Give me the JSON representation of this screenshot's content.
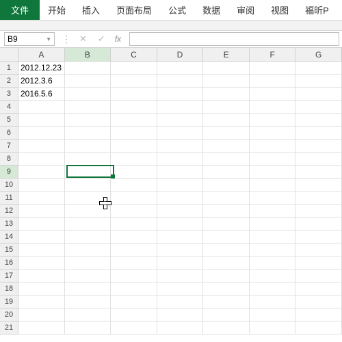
{
  "ribbon": {
    "file": "文件",
    "tabs": [
      "开始",
      "插入",
      "页面布局",
      "公式",
      "数据",
      "审阅",
      "视图",
      "福昕P"
    ]
  },
  "formula_bar": {
    "name_box": "B9",
    "cancel": "✕",
    "confirm": "✓",
    "fx": "fx",
    "value": ""
  },
  "columns": [
    "A",
    "B",
    "C",
    "D",
    "E",
    "F",
    "G"
  ],
  "active_col": "B",
  "rows": [
    {
      "n": 1,
      "cells": [
        "2012.12.23",
        "",
        "",
        "",
        "",
        "",
        ""
      ]
    },
    {
      "n": 2,
      "cells": [
        "2012.3.6",
        "",
        "",
        "",
        "",
        "",
        ""
      ]
    },
    {
      "n": 3,
      "cells": [
        "2016.5.6",
        "",
        "",
        "",
        "",
        "",
        ""
      ]
    },
    {
      "n": 4,
      "cells": [
        "",
        "",
        "",
        "",
        "",
        "",
        ""
      ]
    },
    {
      "n": 5,
      "cells": [
        "",
        "",
        "",
        "",
        "",
        "",
        ""
      ]
    },
    {
      "n": 6,
      "cells": [
        "",
        "",
        "",
        "",
        "",
        "",
        ""
      ]
    },
    {
      "n": 7,
      "cells": [
        "",
        "",
        "",
        "",
        "",
        "",
        ""
      ]
    },
    {
      "n": 8,
      "cells": [
        "",
        "",
        "",
        "",
        "",
        "",
        ""
      ]
    },
    {
      "n": 9,
      "cells": [
        "",
        "",
        "",
        "",
        "",
        "",
        ""
      ]
    },
    {
      "n": 10,
      "cells": [
        "",
        "",
        "",
        "",
        "",
        "",
        ""
      ]
    },
    {
      "n": 11,
      "cells": [
        "",
        "",
        "",
        "",
        "",
        "",
        ""
      ]
    },
    {
      "n": 12,
      "cells": [
        "",
        "",
        "",
        "",
        "",
        "",
        ""
      ]
    },
    {
      "n": 13,
      "cells": [
        "",
        "",
        "",
        "",
        "",
        "",
        ""
      ]
    },
    {
      "n": 14,
      "cells": [
        "",
        "",
        "",
        "",
        "",
        "",
        ""
      ]
    },
    {
      "n": 15,
      "cells": [
        "",
        "",
        "",
        "",
        "",
        "",
        ""
      ]
    },
    {
      "n": 16,
      "cells": [
        "",
        "",
        "",
        "",
        "",
        "",
        ""
      ]
    },
    {
      "n": 17,
      "cells": [
        "",
        "",
        "",
        "",
        "",
        "",
        ""
      ]
    },
    {
      "n": 18,
      "cells": [
        "",
        "",
        "",
        "",
        "",
        "",
        ""
      ]
    },
    {
      "n": 19,
      "cells": [
        "",
        "",
        "",
        "",
        "",
        "",
        ""
      ]
    },
    {
      "n": 20,
      "cells": [
        "",
        "",
        "",
        "",
        "",
        "",
        ""
      ]
    },
    {
      "n": 21,
      "cells": [
        "",
        "",
        "",
        "",
        "",
        "",
        ""
      ]
    }
  ],
  "selection": {
    "col": "B",
    "row": 9
  }
}
